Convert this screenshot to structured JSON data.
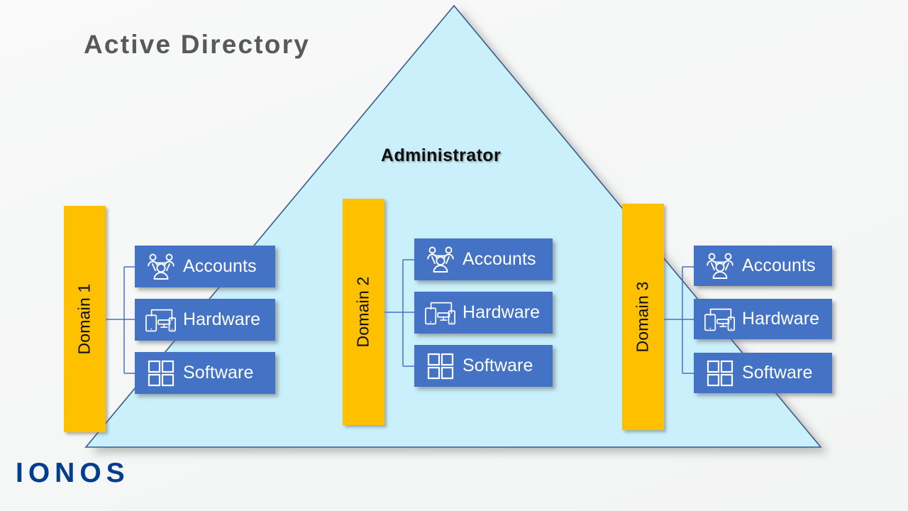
{
  "title": "Active Directory",
  "center_label": "Administrator",
  "brand": "IONOS",
  "colors": {
    "background": "#f7f8f7",
    "triangle_fill": "#caf0fb",
    "triangle_stroke": "#3b5a8c",
    "domain_bar": "#ffc000",
    "node_box": "#4472c4",
    "node_text": "#ffffff",
    "title_text": "#595959",
    "center_text": "#0d0d0d",
    "connector_line": "#4472c4",
    "brand_color": "#003d8f"
  },
  "domains": [
    {
      "bar_label": "Domain 1",
      "nodes": [
        {
          "label": "Accounts",
          "icon": "accounts-people-icon"
        },
        {
          "label": "Hardware",
          "icon": "hardware-devices-icon"
        },
        {
          "label": "Software",
          "icon": "software-grid-icon"
        }
      ]
    },
    {
      "bar_label": "Domain 2",
      "nodes": [
        {
          "label": "Accounts",
          "icon": "accounts-people-icon"
        },
        {
          "label": "Hardware",
          "icon": "hardware-devices-icon"
        },
        {
          "label": "Software",
          "icon": "software-grid-icon"
        }
      ]
    },
    {
      "bar_label": "Domain 3",
      "nodes": [
        {
          "label": "Accounts",
          "icon": "accounts-people-icon"
        },
        {
          "label": "Hardware",
          "icon": "hardware-devices-icon"
        },
        {
          "label": "Software",
          "icon": "software-grid-icon"
        }
      ]
    }
  ]
}
